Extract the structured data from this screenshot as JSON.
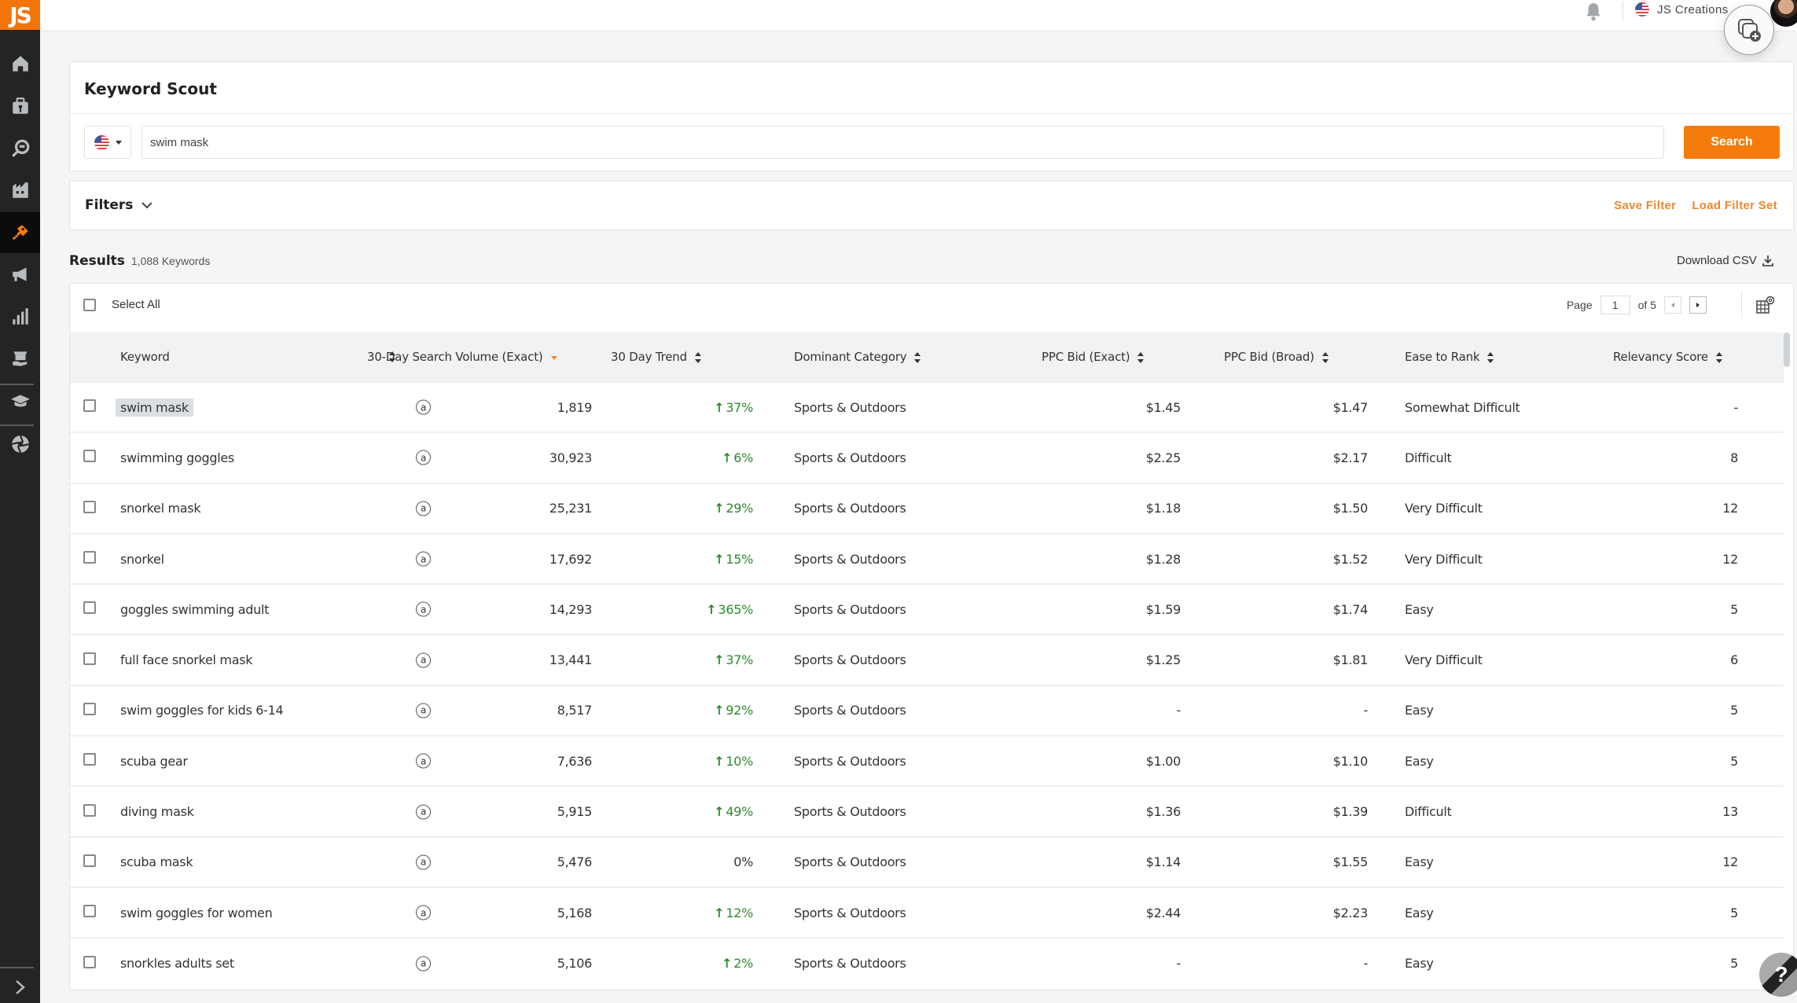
{
  "app": {
    "logo_text": "JS",
    "brand_color": "#f57c0a"
  },
  "sidebar": {
    "items": [
      {
        "name": "home",
        "icon": "home-icon",
        "active": false
      },
      {
        "name": "toolbox",
        "icon": "toolbox-icon",
        "active": false
      },
      {
        "name": "product-research",
        "icon": "magnifier-icon",
        "active": false
      },
      {
        "name": "supplier",
        "icon": "factory-icon",
        "active": false
      },
      {
        "name": "keywords",
        "icon": "key-icon",
        "active": true
      },
      {
        "name": "marketing",
        "icon": "megaphone-icon",
        "active": false
      },
      {
        "name": "analytics",
        "icon": "bar-chart-icon",
        "active": false
      },
      {
        "name": "services",
        "icon": "hand-box-icon",
        "active": false
      },
      {
        "name": "academy",
        "icon": "graduation-cap-icon",
        "active": false
      },
      {
        "name": "extension",
        "icon": "aperture-icon",
        "active": false
      }
    ],
    "expand_icon": "chevron-right-icon"
  },
  "header": {
    "account_name": "JS Creations",
    "marketplace_flag": "us-flag"
  },
  "keyword_scout": {
    "title": "Keyword Scout",
    "marketplace": "US",
    "search_value": "swim mask",
    "search_button": "Search"
  },
  "filters": {
    "label": "Filters",
    "save_filter": "Save Filter",
    "load_filter_set": "Load Filter Set"
  },
  "results": {
    "label": "Results",
    "count": "1,088 Keywords",
    "download_csv": "Download CSV",
    "select_all": "Select All",
    "pagination": {
      "page_label": "Page",
      "current_page": "1",
      "of_label": "of 5"
    }
  },
  "table": {
    "columns": [
      {
        "label": "Keyword",
        "sort": "both"
      },
      {
        "label": "30-Day Search Volume (Exact)",
        "sort": "desc"
      },
      {
        "label": "30 Day Trend",
        "sort": "both"
      },
      {
        "label": "Dominant Category",
        "sort": "both"
      },
      {
        "label": "PPC Bid (Exact)",
        "sort": "both"
      },
      {
        "label": "PPC Bid (Broad)",
        "sort": "both"
      },
      {
        "label": "Ease to Rank",
        "sort": "both"
      },
      {
        "label": "Relevancy Score",
        "sort": "both"
      }
    ],
    "rows": [
      {
        "keyword": "swim mask",
        "highlighted": true,
        "volume": "1,819",
        "trend": "37%",
        "trend_dir": "up",
        "category": "Sports & Outdoors",
        "ppc_exact": "$1.45",
        "ppc_broad": "$1.47",
        "ease": "Somewhat Difficult",
        "relevancy": "-"
      },
      {
        "keyword": "swimming goggles",
        "highlighted": false,
        "volume": "30,923",
        "trend": "6%",
        "trend_dir": "up",
        "category": "Sports & Outdoors",
        "ppc_exact": "$2.25",
        "ppc_broad": "$2.17",
        "ease": "Difficult",
        "relevancy": "8"
      },
      {
        "keyword": "snorkel mask",
        "highlighted": false,
        "volume": "25,231",
        "trend": "29%",
        "trend_dir": "up",
        "category": "Sports & Outdoors",
        "ppc_exact": "$1.18",
        "ppc_broad": "$1.50",
        "ease": "Very Difficult",
        "relevancy": "12"
      },
      {
        "keyword": "snorkel",
        "highlighted": false,
        "volume": "17,692",
        "trend": "15%",
        "trend_dir": "up",
        "category": "Sports & Outdoors",
        "ppc_exact": "$1.28",
        "ppc_broad": "$1.52",
        "ease": "Very Difficult",
        "relevancy": "12"
      },
      {
        "keyword": "goggles swimming adult",
        "highlighted": false,
        "volume": "14,293",
        "trend": "365%",
        "trend_dir": "up",
        "category": "Sports & Outdoors",
        "ppc_exact": "$1.59",
        "ppc_broad": "$1.74",
        "ease": "Easy",
        "relevancy": "5"
      },
      {
        "keyword": "full face snorkel mask",
        "highlighted": false,
        "volume": "13,441",
        "trend": "37%",
        "trend_dir": "up",
        "category": "Sports & Outdoors",
        "ppc_exact": "$1.25",
        "ppc_broad": "$1.81",
        "ease": "Very Difficult",
        "relevancy": "6"
      },
      {
        "keyword": "swim goggles for kids 6-14",
        "highlighted": false,
        "volume": "8,517",
        "trend": "92%",
        "trend_dir": "up",
        "category": "Sports & Outdoors",
        "ppc_exact": "-",
        "ppc_broad": "-",
        "ease": "Easy",
        "relevancy": "5"
      },
      {
        "keyword": "scuba gear",
        "highlighted": false,
        "volume": "7,636",
        "trend": "10%",
        "trend_dir": "up",
        "category": "Sports & Outdoors",
        "ppc_exact": "$1.00",
        "ppc_broad": "$1.10",
        "ease": "Easy",
        "relevancy": "5"
      },
      {
        "keyword": "diving mask",
        "highlighted": false,
        "volume": "5,915",
        "trend": "49%",
        "trend_dir": "up",
        "category": "Sports & Outdoors",
        "ppc_exact": "$1.36",
        "ppc_broad": "$1.39",
        "ease": "Difficult",
        "relevancy": "13"
      },
      {
        "keyword": "scuba mask",
        "highlighted": false,
        "volume": "5,476",
        "trend": "0%",
        "trend_dir": "flat",
        "category": "Sports & Outdoors",
        "ppc_exact": "$1.14",
        "ppc_broad": "$1.55",
        "ease": "Easy",
        "relevancy": "12"
      },
      {
        "keyword": "swim goggles for women",
        "highlighted": false,
        "volume": "5,168",
        "trend": "12%",
        "trend_dir": "up",
        "category": "Sports & Outdoors",
        "ppc_exact": "$2.44",
        "ppc_broad": "$2.23",
        "ease": "Easy",
        "relevancy": "5"
      },
      {
        "keyword": "snorkles adults set",
        "highlighted": false,
        "volume": "5,106",
        "trend": "2%",
        "trend_dir": "up",
        "category": "Sports & Outdoors",
        "ppc_exact": "-",
        "ppc_broad": "-",
        "ease": "Easy",
        "relevancy": "5"
      }
    ],
    "trend_up_color": "#2e8b2e",
    "sort_active_color": "#f08a2a"
  },
  "overlays": {
    "help_label": "?"
  }
}
